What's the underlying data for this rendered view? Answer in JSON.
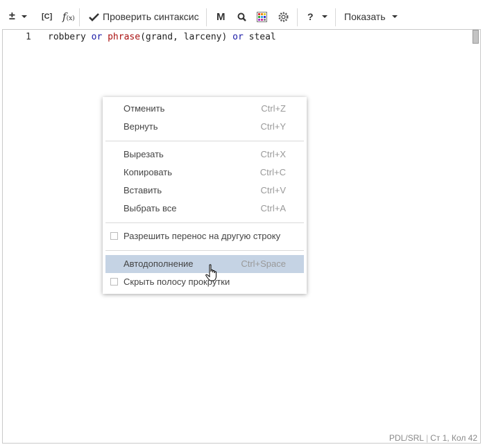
{
  "toolbar": {
    "plusminus": "±",
    "context_code": "[C]",
    "fx": "f",
    "fx_sub": "(x)",
    "check_syntax_label": "Проверить синтаксис",
    "m_label": "M",
    "help_label": "?",
    "show_label": "Показать"
  },
  "editor": {
    "line_number": "1",
    "code": {
      "t1": "robbery ",
      "t2": "or",
      "t3": " ",
      "t4": "phrase",
      "t5": "(grand, larceny) ",
      "t6": "or",
      "t7": " steal"
    }
  },
  "status": {
    "language": "PDL/SRL",
    "position": "Ст 1, Кол 42"
  },
  "context_menu": {
    "undo": {
      "label": "Отменить",
      "shortcut": "Ctrl+Z"
    },
    "redo": {
      "label": "Вернуть",
      "shortcut": "Ctrl+Y"
    },
    "cut": {
      "label": "Вырезать",
      "shortcut": "Ctrl+X"
    },
    "copy": {
      "label": "Копировать",
      "shortcut": "Ctrl+C"
    },
    "paste": {
      "label": "Вставить",
      "shortcut": "Ctrl+V"
    },
    "select_all": {
      "label": "Выбрать все",
      "shortcut": "Ctrl+A"
    },
    "wrap": {
      "label": "Разрешить перенос на другую строку",
      "checked": false
    },
    "autocomplete": {
      "label": "Автодополнение",
      "shortcut": "Ctrl+Space"
    },
    "hide_scrollbar": {
      "label": "Скрыть полосу прокрутки",
      "checked": false
    }
  },
  "colors": {
    "keyword": "#1a1aa6",
    "function": "#aa1111",
    "menu_highlight": "#c5d3e4"
  }
}
